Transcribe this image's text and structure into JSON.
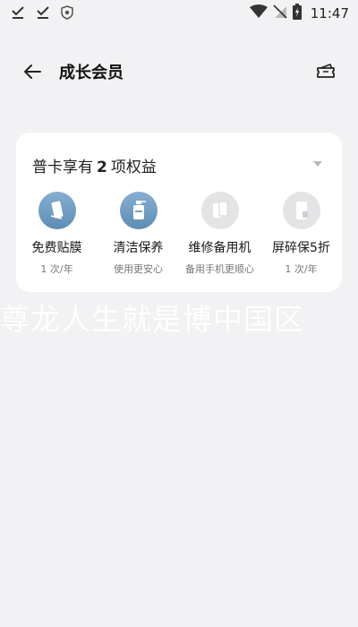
{
  "status_bar": {
    "time": "11:47",
    "icons": [
      "check-icon",
      "check-icon",
      "shield-icon",
      "wifi-icon",
      "no-signal-icon",
      "battery-charging-icon"
    ]
  },
  "header": {
    "title": "成长会员",
    "back_icon": "arrow-left-icon",
    "action_icon": "ticket-icon"
  },
  "card": {
    "title_prefix": "普卡享有",
    "title_count": "2",
    "title_suffix": "项权益",
    "benefits": [
      {
        "name": "免费贴膜",
        "sub": "1 次/年",
        "icon": "screen-film-icon",
        "active": true
      },
      {
        "name": "清洁保养",
        "sub": "使用更安心",
        "icon": "cleaning-bottle-icon",
        "active": true
      },
      {
        "name": "维修备用机",
        "sub": "备用手机更顺心",
        "icon": "spare-phone-icon",
        "active": false
      },
      {
        "name": "屏碎保5折",
        "sub": "1 次/年",
        "icon": "screen-protection-icon",
        "active": false
      }
    ]
  },
  "watermark": "尊龙人生就是博中国区",
  "colors": {
    "background": "#f2f2f4",
    "card": "#ffffff",
    "active_icon": "#6f9bc2",
    "inactive_icon": "#e4e4e6"
  }
}
